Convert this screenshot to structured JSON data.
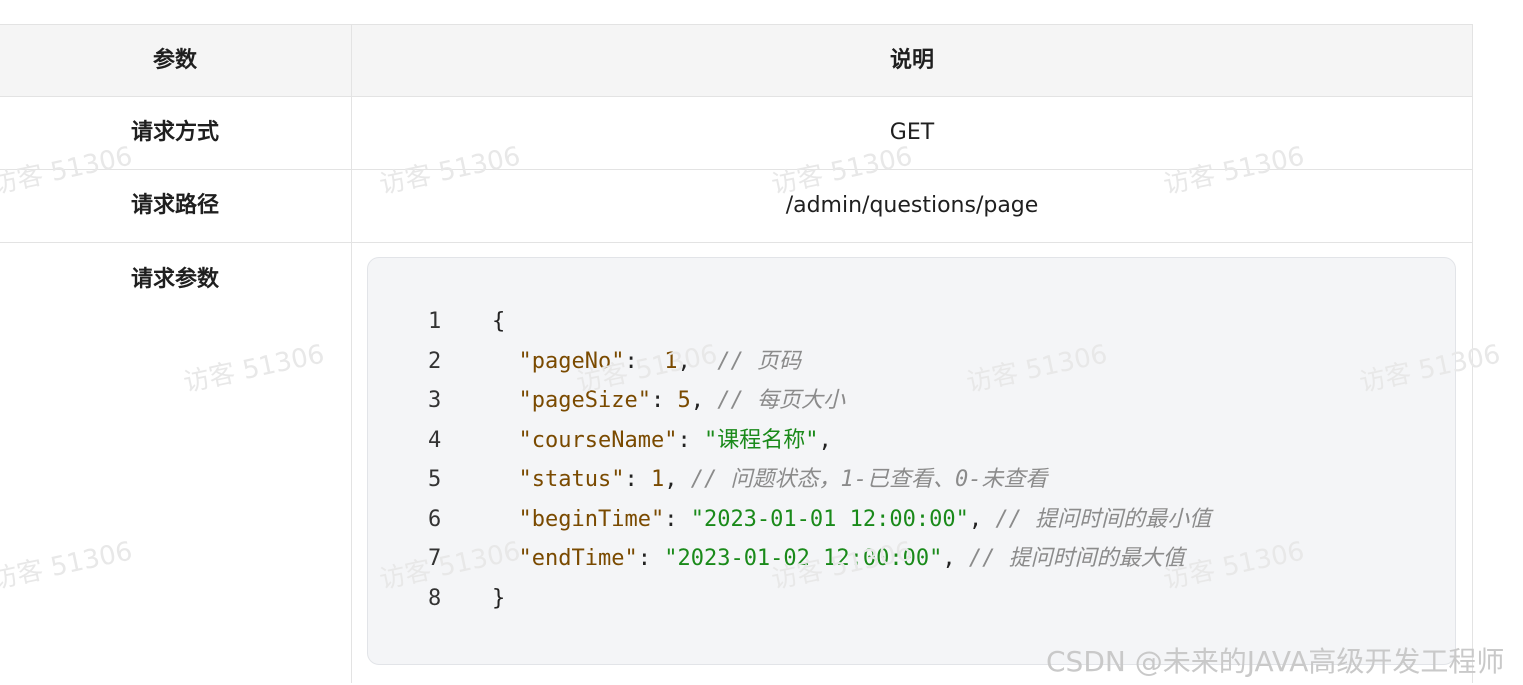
{
  "table": {
    "header": {
      "param": "参数",
      "desc": "说明"
    },
    "rows": [
      {
        "param": "请求方式",
        "value": "GET"
      },
      {
        "param": "请求路径",
        "value": "/admin/questions/page"
      }
    ],
    "params_label": "请求参数"
  },
  "code": {
    "line_numbers": [
      "1",
      "2",
      "3",
      "4",
      "5",
      "6",
      "7",
      "8"
    ],
    "l1": {
      "open": "{"
    },
    "l2": {
      "key": "\"pageNo\"",
      "sep": ": ",
      "val": " 1",
      "punct": ",  ",
      "comment": "// 页码"
    },
    "l3": {
      "key": "\"pageSize\"",
      "sep": ": ",
      "val": "5",
      "punct": ", ",
      "comment": "// 每页大小"
    },
    "l4": {
      "key": "\"courseName\"",
      "sep": ": ",
      "val": "\"课程名称\"",
      "punct": ","
    },
    "l5": {
      "key": "\"status\"",
      "sep": ": ",
      "val": "1",
      "punct": ", ",
      "comment": "// 问题状态，1-已查看、0-未查看"
    },
    "l6": {
      "key": "\"beginTime\"",
      "sep": ": ",
      "val": "\"2023-01-01 12:00:00\"",
      "punct": ", ",
      "comment": "// 提问时间的最小值"
    },
    "l7": {
      "key": "\"endTime\"",
      "sep": ": ",
      "val": "\"2023-01-02 12:00:00\"",
      "punct": ", ",
      "comment": "// 提问时间的最大值"
    },
    "l8": {
      "close": "}"
    }
  },
  "watermark": "访客 51306",
  "credit": "CSDN @未来的JAVA高级开发工程师"
}
